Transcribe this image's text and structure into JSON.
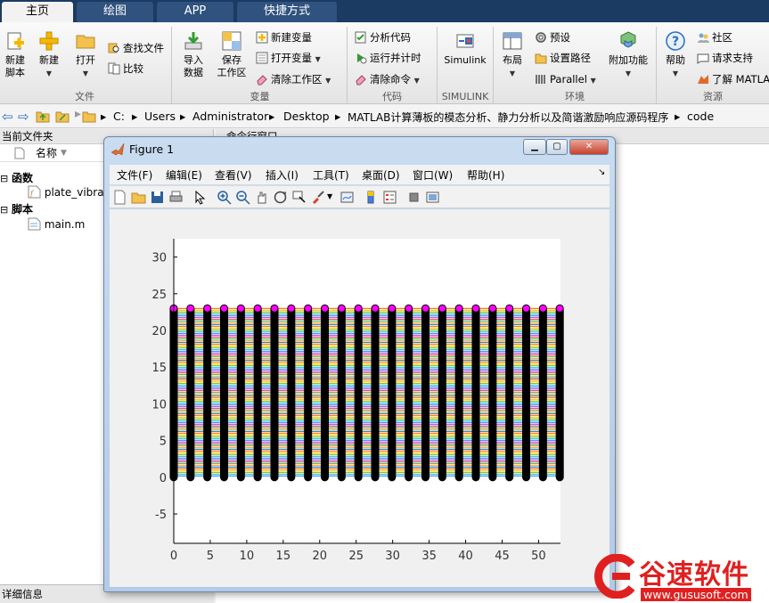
{
  "tabs": [
    {
      "label": "主页",
      "active": true
    },
    {
      "label": "绘图",
      "active": false
    },
    {
      "label": "APP",
      "active": false
    },
    {
      "label": "快捷方式",
      "active": false
    }
  ],
  "ribbon": {
    "file": {
      "section": "文件",
      "new_script": [
        "新建",
        "脚本"
      ],
      "new": "新建",
      "open": "打开",
      "find_files": "查找文件",
      "compare": "比较"
    },
    "variable": {
      "section": "变量",
      "import": [
        "导入",
        "数据"
      ],
      "save_ws": [
        "保存",
        "工作区"
      ],
      "new_var": "新建变量",
      "open_var": "打开变量",
      "clear_ws": "清除工作区"
    },
    "code": {
      "section": "代码",
      "analyze": "分析代码",
      "run_time": "运行并计时",
      "clear_cmd": "清除命令"
    },
    "simulink": {
      "section": "SIMULINK",
      "label": "Simulink"
    },
    "env": {
      "section": "环境",
      "layout": "布局",
      "prefs": "预设",
      "set_path": "设置路径",
      "parallel": "Parallel",
      "addons": "附加功能"
    },
    "resources": {
      "section": "资源",
      "help": "帮助",
      "community": "社区",
      "support": "请求支持",
      "learn": "了解 MATLAB"
    }
  },
  "address": {
    "path": [
      "C:",
      "Users",
      "Administrator",
      "Desktop",
      "MATLAB计算薄板的模态分析、静力分析以及简谐激励响应源码程序",
      "code"
    ]
  },
  "left_panel": {
    "title": "当前文件夹",
    "col_name": "名称",
    "groups": [
      {
        "label": "函数",
        "files": [
          "plate_vibrat"
        ]
      },
      {
        "label": "脚本",
        "files": [
          "main.m"
        ]
      }
    ],
    "details": "详细信息"
  },
  "right_panel": {
    "title": "命令行窗口"
  },
  "figure": {
    "title": "Figure 1",
    "menus": [
      "文件(F)",
      "编辑(E)",
      "查看(V)",
      "插入(I)",
      "工具(T)",
      "桌面(D)",
      "窗口(W)",
      "帮助(H)"
    ]
  },
  "chart_data": {
    "type": "line",
    "x_ticks": [
      0,
      5,
      10,
      15,
      20,
      25,
      30,
      35,
      40,
      45,
      50
    ],
    "y_ticks": [
      -5,
      0,
      5,
      10,
      15,
      20,
      25,
      30
    ],
    "xlim": [
      0,
      53
    ],
    "ylim": [
      -9,
      32.5
    ],
    "grid": false,
    "vertical_lines": {
      "x": [
        0,
        2.3,
        4.6,
        6.9,
        9.2,
        11.5,
        13.8,
        16.1,
        18.4,
        20.7,
        23,
        25.3,
        27.6,
        29.9,
        32.2,
        34.5,
        36.8,
        39.1,
        41.4,
        43.7,
        46,
        48.3,
        50.6,
        52.9
      ],
      "y_from": 0,
      "y_to": 23,
      "color": "#000000",
      "marker_color": "#ff00ff"
    },
    "horizontal_band": {
      "y_from": 0,
      "y_to": 23,
      "colors": [
        "#ff6a00",
        "#f5c400",
        "#8ab800",
        "#1ec7c7",
        "#3d7bff",
        "#a04bd8",
        "#e03a6a",
        "#4caf50",
        "#ff9e2c",
        "#1f77b4"
      ]
    }
  },
  "watermark": {
    "brand": "谷速软件",
    "url": "www.gususoft.com",
    "color": "#e02020"
  }
}
